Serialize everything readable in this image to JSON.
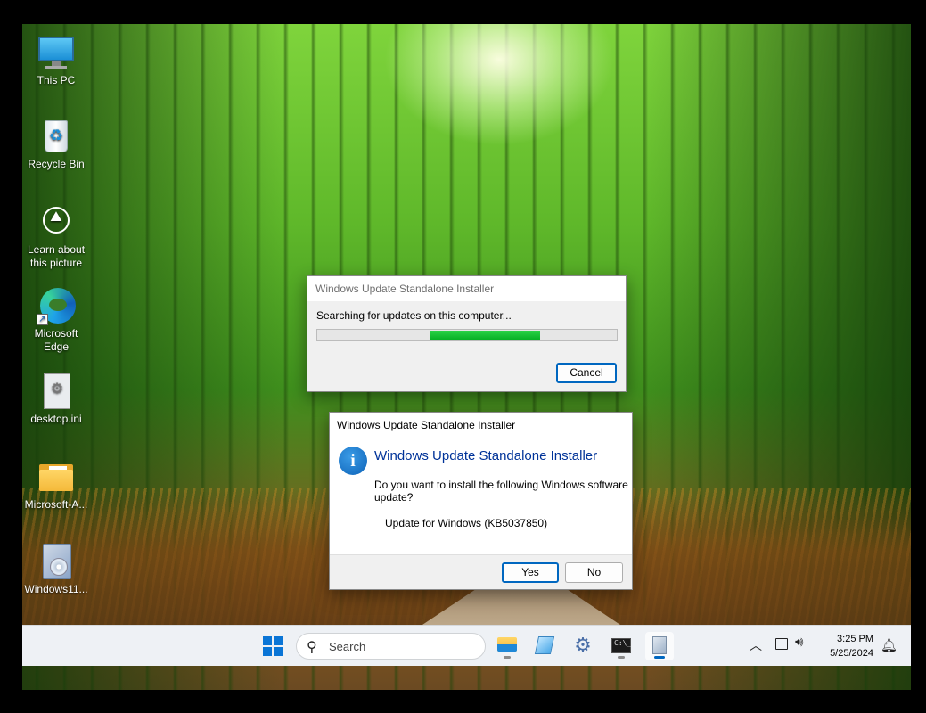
{
  "desktop": {
    "icons": [
      {
        "label": "This PC",
        "icon": "this-pc-icon"
      },
      {
        "label": "Recycle Bin",
        "icon": "recycle-bin-icon"
      },
      {
        "label": "Learn about this picture",
        "icon": "learn-about-picture-icon"
      },
      {
        "label": "Microsoft Edge",
        "icon": "microsoft-edge-icon"
      },
      {
        "label": "desktop.ini",
        "icon": "settings-file-icon"
      },
      {
        "label": "Microsoft-A...",
        "icon": "folder-icon"
      },
      {
        "label": "Windows11...",
        "icon": "setup-icon"
      }
    ]
  },
  "progress_dialog": {
    "title": "Windows Update Standalone Installer",
    "message": "Searching for updates on this computer...",
    "progress": "marquee",
    "cancel_label": "Cancel",
    "colors": {
      "progress_fill": "#06b025"
    }
  },
  "confirm_dialog": {
    "title": "Windows Update Standalone Installer",
    "heading": "Windows Update Standalone Installer",
    "question": "Do you want to install the following Windows software update?",
    "update_name": "Update for Windows (KB5037850)",
    "yes_label": "Yes",
    "no_label": "No",
    "icon": "info-icon",
    "colors": {
      "heading": "#003399",
      "accent": "#0067c0"
    }
  },
  "taskbar": {
    "search_placeholder": "Search",
    "apps": [
      "file-explorer-icon",
      "notepad-icon",
      "settings-icon",
      "terminal-icon",
      "installer-icon"
    ],
    "time": "3:25 PM",
    "date": "5/25/2024"
  }
}
